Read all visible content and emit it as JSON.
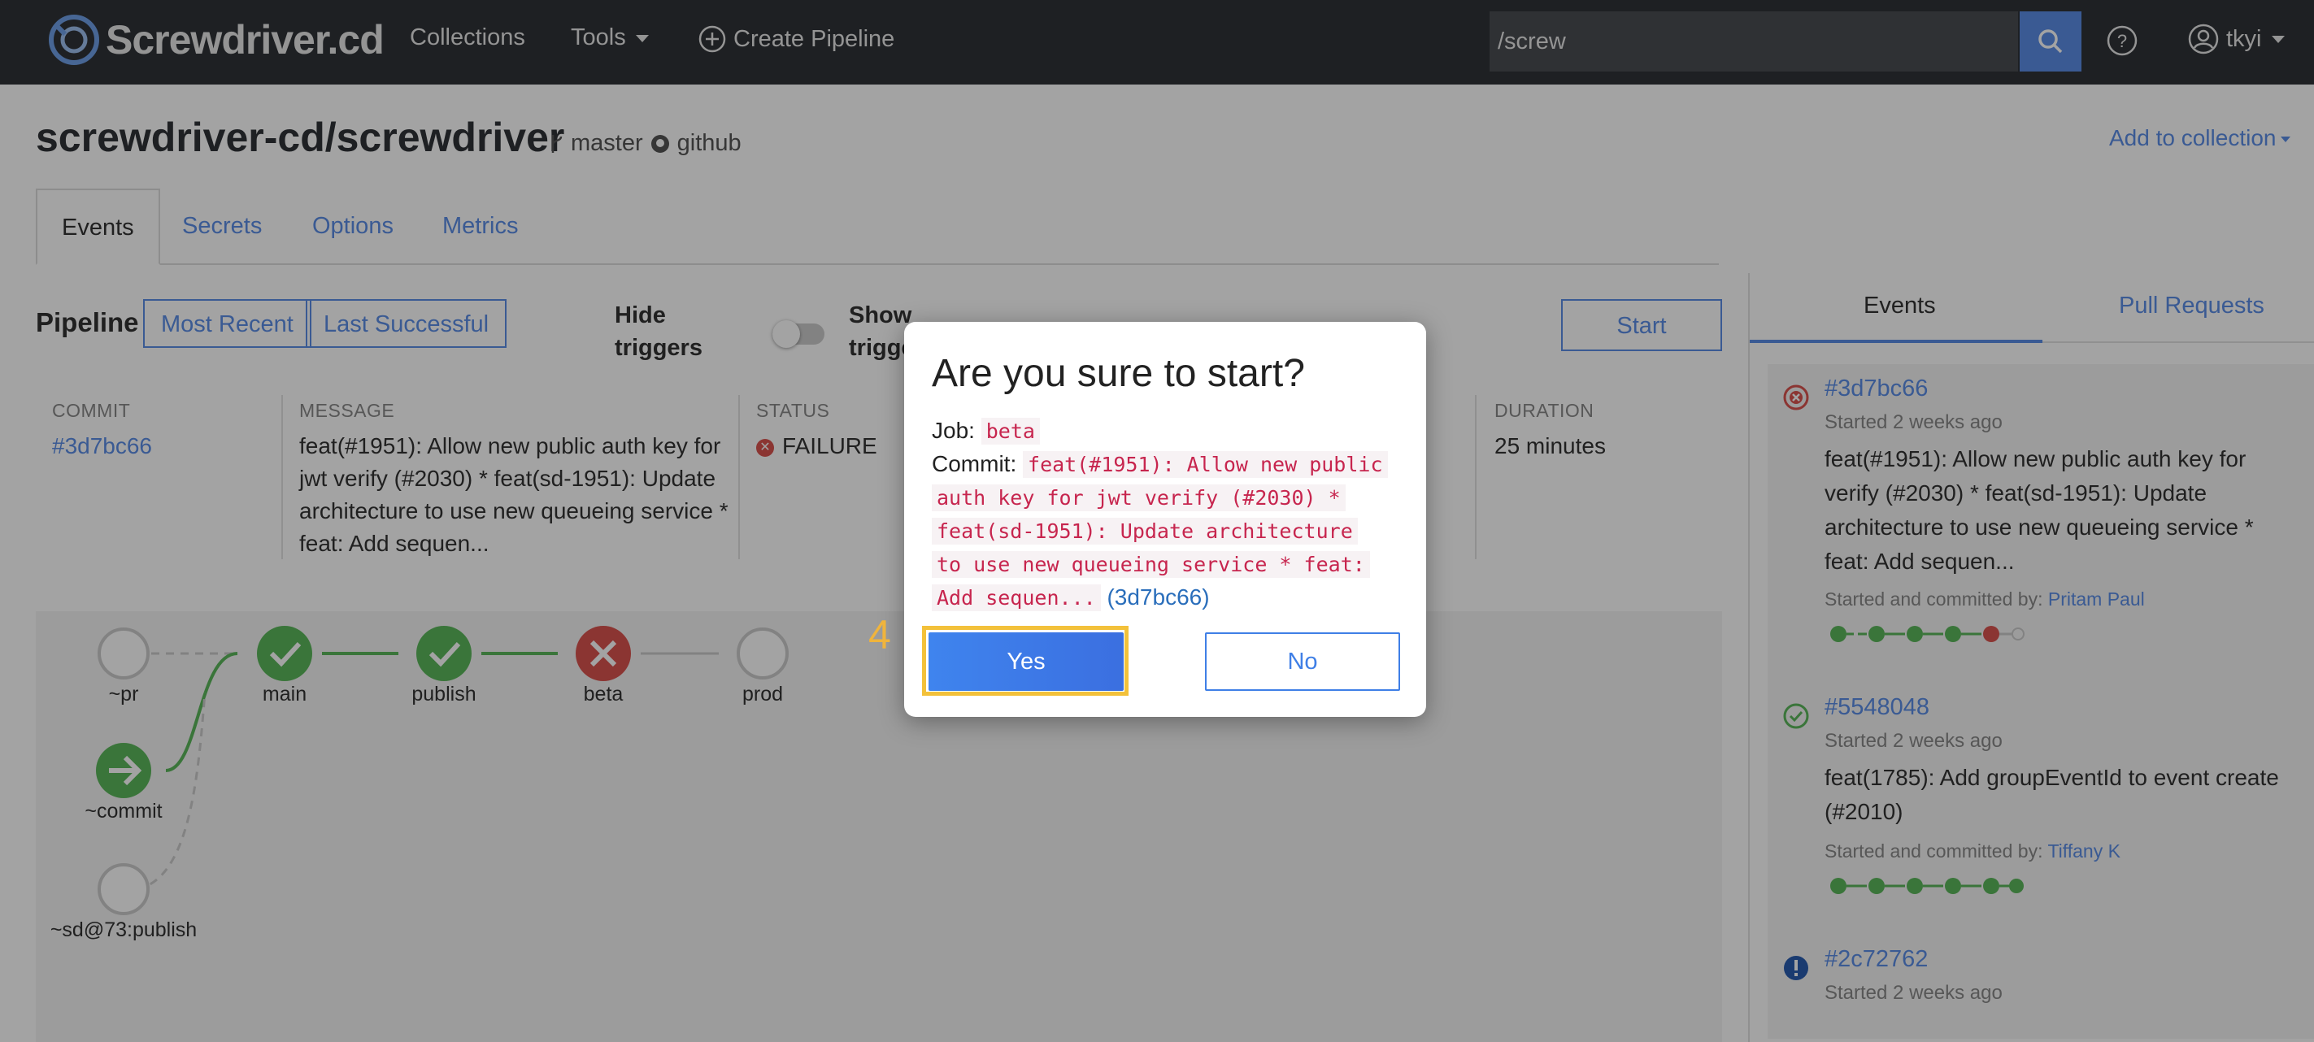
{
  "navbar": {
    "brand": "Screwdriver.cd",
    "links": [
      "Collections",
      "Tools",
      "Create Pipeline"
    ],
    "search_value": "/screw",
    "user": "tkyi"
  },
  "header": {
    "repo": "screwdriver-cd/screwdriver",
    "branch": "master",
    "source": "github",
    "add_collection": "Add to collection"
  },
  "tabs": [
    "Events",
    "Secrets",
    "Options",
    "Metrics"
  ],
  "pipeline": {
    "label": "Pipeline",
    "most_recent": "Most Recent",
    "last_successful": "Last Successful",
    "hide_triggers": [
      "Hide",
      "triggers"
    ],
    "show_triggers": [
      "Show",
      "trigge"
    ],
    "start": "Start"
  },
  "event_info": {
    "commit_label": "COMMIT",
    "commit": "#3d7bc66",
    "message_label": "MESSAGE",
    "message_lines": [
      "feat(#1951): Allow new public auth key for",
      "jwt verify (#2030) * feat(sd-1951): Update",
      "architecture to use new queueing service  *",
      "feat: Add sequen..."
    ],
    "status_label": "STATUS",
    "status": "FAILURE",
    "duration_label": "DURATION",
    "duration": "25 minutes"
  },
  "graph": {
    "nodes": [
      "~pr",
      "main",
      "publish",
      "beta",
      "prod",
      "~commit",
      "~sd@73:publish"
    ]
  },
  "right_panel": {
    "tabs": [
      "Events",
      "Pull Requests"
    ],
    "events": [
      {
        "sha": "#3d7bc66",
        "time": "Started 2 weeks ago",
        "message_lines": [
          "feat(#1951): Allow new public auth key for",
          "verify (#2030) * feat(sd-1951): Update",
          "architecture to use new queueing service  *",
          "feat: Add sequen..."
        ],
        "by_prefix": "Started and committed by:",
        "user": "Pritam Paul",
        "status": "failure"
      },
      {
        "sha": "#5548048",
        "time": "Started 2 weeks ago",
        "message_lines": [
          "feat(1785): Add groupEventId to event create",
          "(#2010)"
        ],
        "by_prefix": "Started and committed by:",
        "user": "Tiffany K",
        "status": "success"
      },
      {
        "sha": "#2c72762",
        "time": "Started 2 weeks ago",
        "status": "warning"
      }
    ]
  },
  "modal": {
    "title": "Are you sure to start?",
    "job_label": "Job:",
    "job": "beta",
    "commit_label": "Commit:",
    "commit_lines": [
      "feat(#1951): Allow new public",
      "auth key for jwt verify (#2030) *",
      "feat(sd-1951): Update architecture",
      "to use new queueing service  * feat:",
      "Add sequen..."
    ],
    "commit_sha": "(3d7bc66)",
    "step_number": "4",
    "yes": "Yes",
    "no": "No"
  },
  "colors": {
    "accent": "#5b8ee6",
    "success": "#5cb85c",
    "failure": "#d9534f",
    "highlight": "#f3c13a"
  }
}
